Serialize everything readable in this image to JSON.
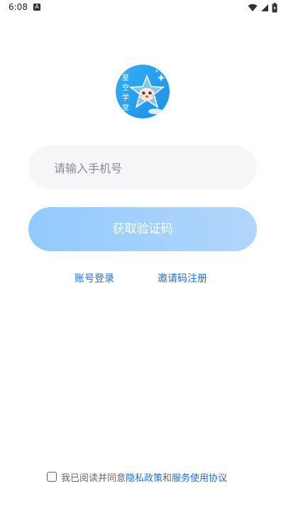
{
  "status_bar": {
    "time": "6:08",
    "notification_letter": "A"
  },
  "logo": {
    "text": "星空学堂"
  },
  "phone_input": {
    "placeholder": "请输入手机号",
    "value": ""
  },
  "buttons": {
    "get_code": "获取验证码"
  },
  "links": {
    "account_login": "账号登录",
    "invite_register": "邀请码注册"
  },
  "agreement": {
    "checked": false,
    "prefix": "我已阅读并同意",
    "privacy_policy": "隐私政策",
    "conjunction": "和",
    "service_agreement": "服务使用协议"
  },
  "colors": {
    "accent": "#1f6fd6",
    "button_start": "#92cafd",
    "button_end": "#b2d6fb",
    "input_bg": "#f5f6f8"
  }
}
